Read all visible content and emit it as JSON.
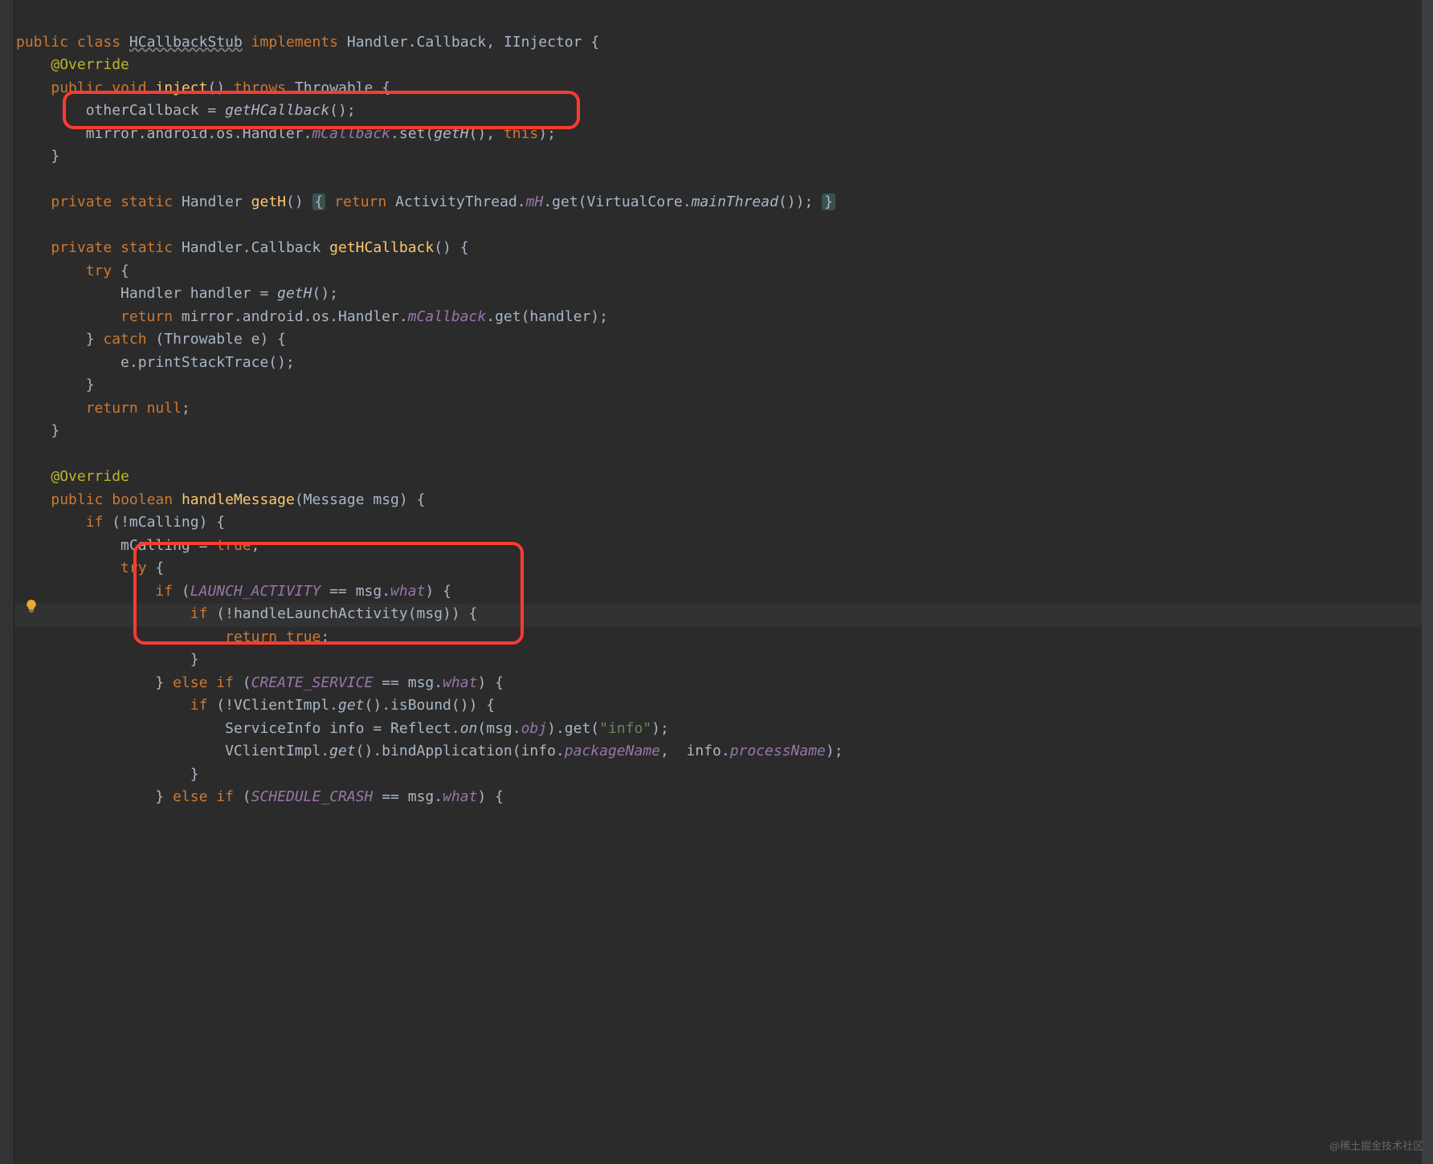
{
  "code": {
    "public": "public",
    "class": "class",
    "class_name": "HCallbackStub",
    "implements": "implements",
    "handler_callback": "Handler.Callback",
    "iinjector": "IInjector",
    "override": "@Override",
    "void": "void",
    "inject": "inject",
    "throws": "throws",
    "throwable": "Throwable",
    "othercallback": "otherCallback",
    "eq": " = ",
    "gethcallback_call": "getHCallback",
    "mirror_pkg": "mirror.android.os.Handler.",
    "mcallback": "mCallback",
    "set": ".set(",
    "geth_call": "getH",
    "this": "this",
    "private": "private",
    "static": "static",
    "handler": "Handler",
    "geth": "getH",
    "return": "return",
    "activitythread": "ActivityThread.",
    "mh": "mH",
    "get": ".get(",
    "virtualcore": "VirtualCore.",
    "mainthread": "mainThread",
    "handler_cb_type": "Handler.Callback",
    "gethcallback": "getHCallback",
    "try": "try",
    "handler_var": "Handler handler = ",
    "get_handler": ".get(handler);",
    "catch": "catch",
    "throwable_e": "Throwable e",
    "print_stack": "e.printStackTrace();",
    "null": "null",
    "boolean": "boolean",
    "handle_message": "handleMessage",
    "message_msg": "Message msg",
    "if": "if",
    "not_mcalling": "(!mCalling) {",
    "mcalling_assign": "mCalling",
    "true": "true",
    "launch_activity": "LAUNCH_ACTIVITY",
    "eqeq": " == ",
    "msg_what": "msg.",
    "what": "what",
    "handle_launch": "handleLaunchActivity",
    "msg_arg": "(msg)) {",
    "else": "else",
    "create_service": "CREATE_SERVICE",
    "vclientimpl": "VClientImpl.",
    "get_call": "get",
    "is_bound": ".isBound()) {",
    "serviceinfo": "ServiceInfo info = Reflect.",
    "on": "on",
    "msg_obj": "(msg.",
    "obj": "obj",
    "get_info": ".get(",
    "info_str": "\"info\"",
    "bind_app": ".bindApplication(info.",
    "packagename": "packageName",
    "comma_info": ",  info.",
    "processname": "processName",
    "schedule_crash": "SCHEDULE_CRASH"
  },
  "ui": {
    "watermark": "@稀土掘金技术社区"
  }
}
